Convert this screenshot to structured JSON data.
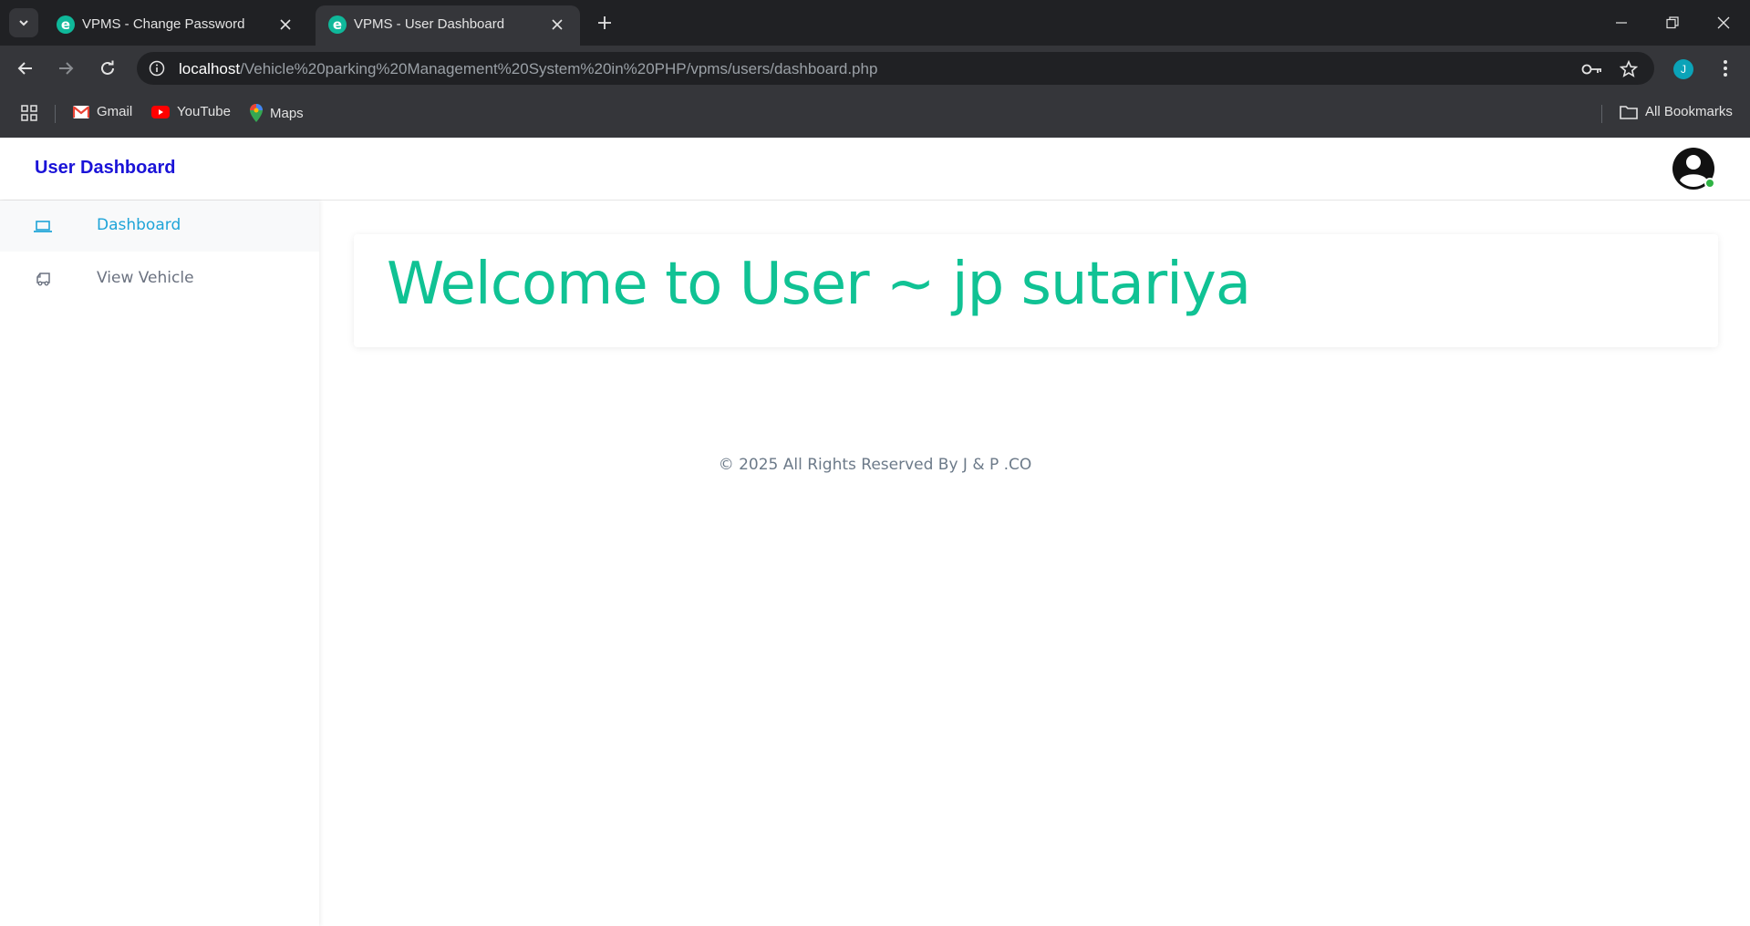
{
  "browser": {
    "tabs": [
      {
        "title": "VPMS - Change Password",
        "favicon": "e",
        "active": false
      },
      {
        "title": "VPMS - User Dashboard",
        "favicon": "e",
        "active": true
      }
    ],
    "url_host": "localhost",
    "url_path": "/Vehicle%20parking%20Management%20System%20in%20PHP/vpms/users/dashboard.php",
    "profile_initial": "J",
    "bookmarks": [
      {
        "label": "Gmail",
        "icon": "gmail-icon"
      },
      {
        "label": "YouTube",
        "icon": "youtube-icon"
      },
      {
        "label": "Maps",
        "icon": "maps-icon"
      }
    ],
    "all_bookmarks_label": "All Bookmarks"
  },
  "app": {
    "brand": "User Dashboard",
    "brand_color": "#1a13d8",
    "accent_color": "#10c294",
    "sidebar": {
      "items": [
        {
          "label": "Dashboard",
          "icon": "laptop-icon",
          "active": true
        },
        {
          "label": "View Vehicle",
          "icon": "truck-icon",
          "active": false
        }
      ]
    },
    "welcome": "Welcome to User ~ jp sutariya",
    "footer": "© 2025 All Rights Reserved By J & P .CO"
  }
}
